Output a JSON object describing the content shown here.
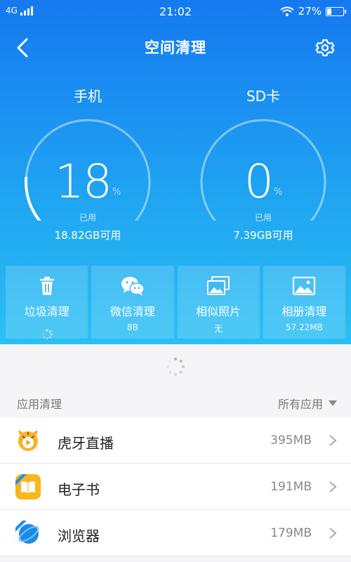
{
  "status_bar": {
    "network": "4G",
    "time": "21:02",
    "battery": "27%",
    "battery_level": 0.27
  },
  "header": {
    "title": "空间清理",
    "back_icon": "chevron-left-icon",
    "settings_icon": "gear-icon"
  },
  "storage": {
    "phone": {
      "label": "手机",
      "percent": "18",
      "unit": "%",
      "used_label": "已用",
      "available": "18.82GB可用",
      "level": 0.18
    },
    "sd": {
      "label": "SD卡",
      "percent": "0",
      "unit": "%",
      "used_label": "已用",
      "available": "7.39GB可用",
      "level": 0.0
    }
  },
  "tools": [
    {
      "label": "垃圾清理",
      "sub": "",
      "icon": "trash-icon",
      "loading": true
    },
    {
      "label": "微信清理",
      "sub": "8B",
      "icon": "wechat-icon"
    },
    {
      "label": "相似照片",
      "sub": "无",
      "icon": "photos-icon"
    },
    {
      "label": "相册清理",
      "sub": "57.22MB",
      "icon": "album-icon"
    }
  ],
  "apps_section": {
    "title": "应用清理",
    "filter": "所有应用"
  },
  "apps": [
    {
      "name": "虎牙直播",
      "size": "395MB",
      "icon": "huya-icon"
    },
    {
      "name": "电子书",
      "size": "191MB",
      "icon": "ebook-icon"
    },
    {
      "name": "浏览器",
      "size": "179MB",
      "icon": "browser-icon"
    }
  ],
  "colors": {
    "accent": "#1579f0",
    "accent_light": "#2bc0f3"
  }
}
